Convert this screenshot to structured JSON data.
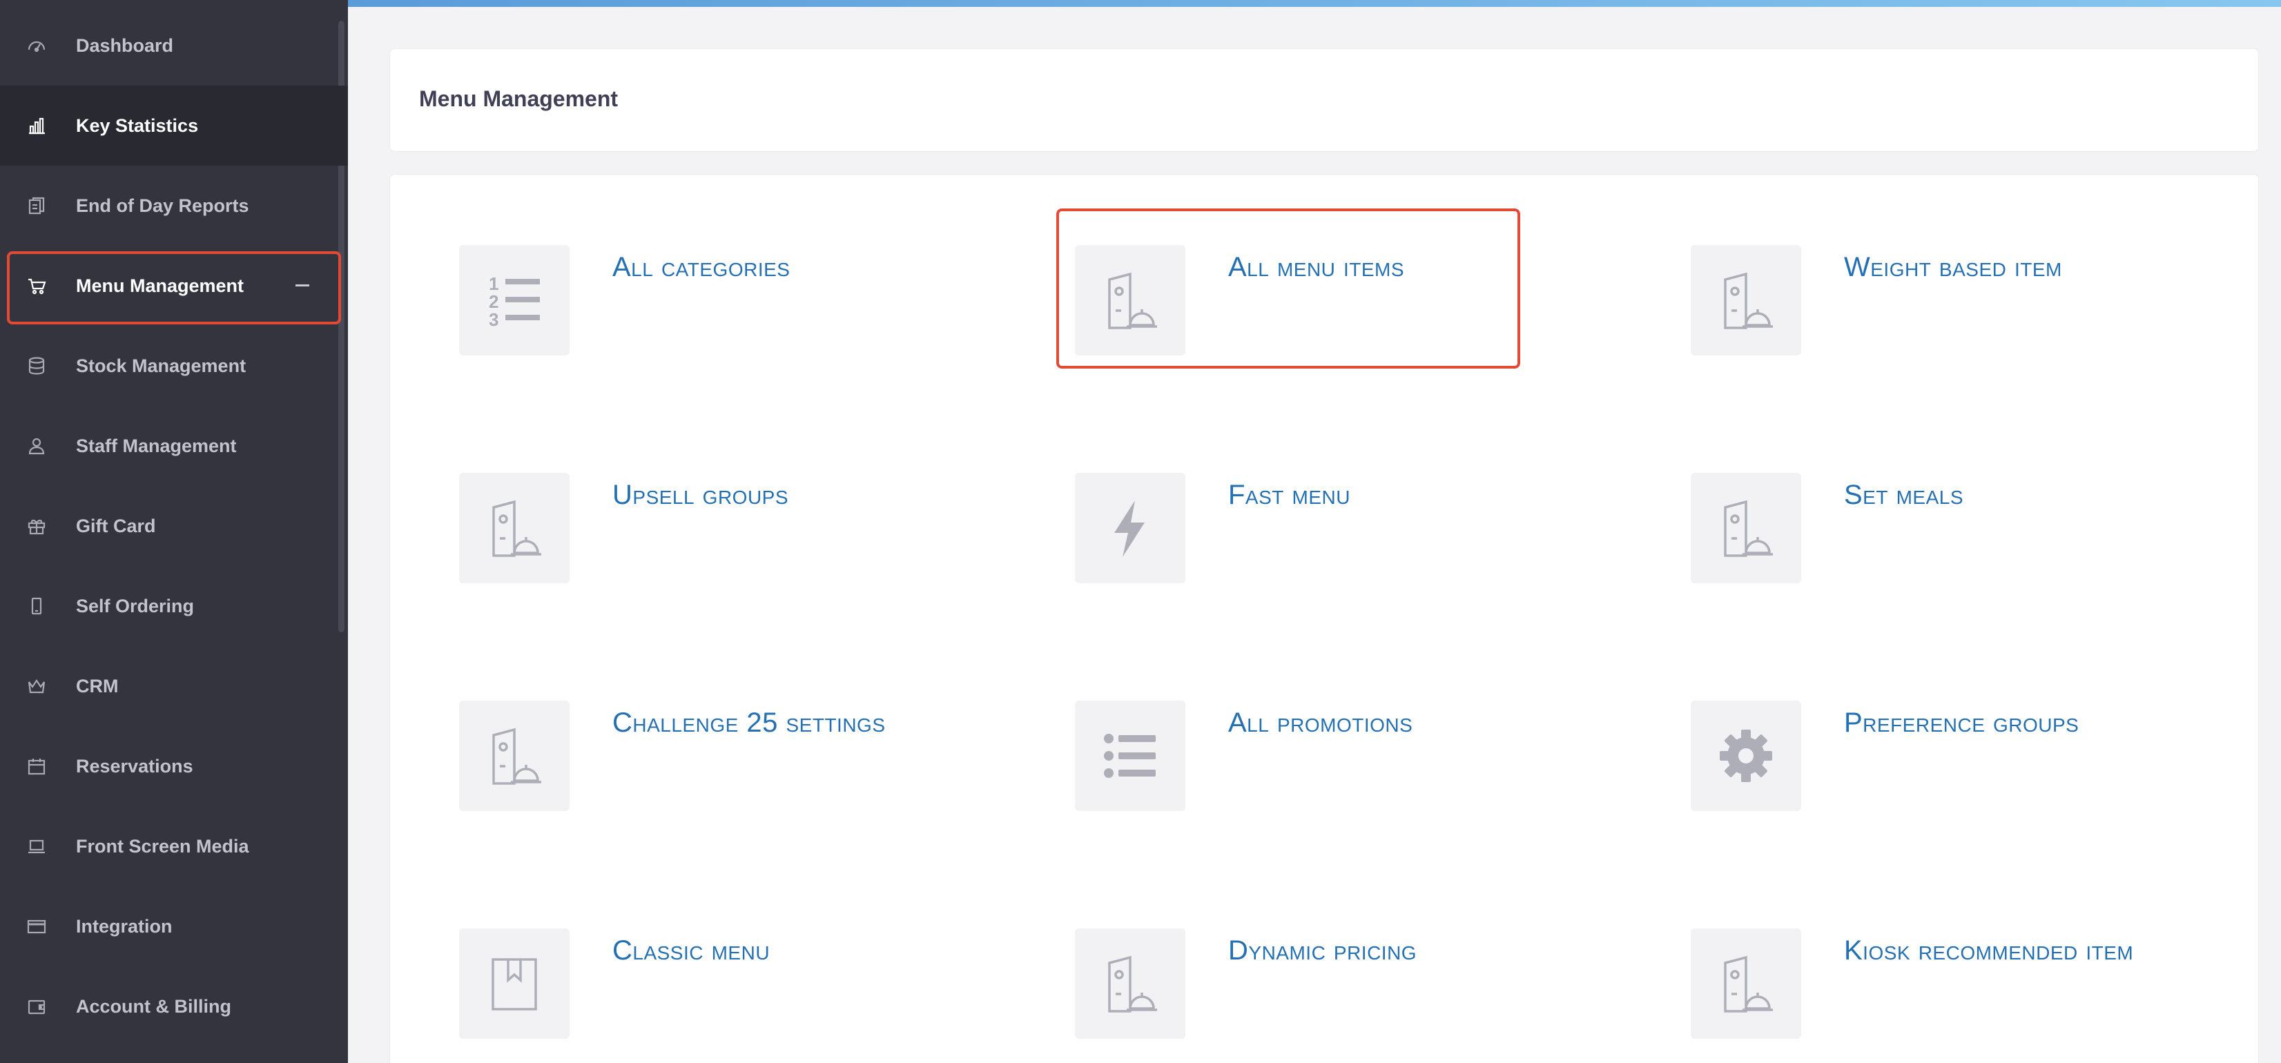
{
  "sidebar": {
    "items": [
      {
        "label": "Dashboard",
        "icon": "dashboard-icon"
      },
      {
        "label": "Key Statistics",
        "icon": "bar-chart-icon"
      },
      {
        "label": "End of Day Reports",
        "icon": "reports-icon"
      },
      {
        "label": "Menu Management",
        "icon": "cart-icon"
      },
      {
        "label": "Stock Management",
        "icon": "database-icon"
      },
      {
        "label": "Staff Management",
        "icon": "user-icon"
      },
      {
        "label": "Gift Card",
        "icon": "gift-icon"
      },
      {
        "label": "Self Ordering",
        "icon": "mobile-icon"
      },
      {
        "label": "CRM",
        "icon": "crown-icon"
      },
      {
        "label": "Reservations",
        "icon": "calendar-icon"
      },
      {
        "label": "Front Screen Media",
        "icon": "laptop-icon"
      },
      {
        "label": "Integration",
        "icon": "card-icon"
      },
      {
        "label": "Account & Billing",
        "icon": "wallet-icon"
      }
    ],
    "active_item": "Key Statistics",
    "expanded_item": "Menu Management",
    "collapse_symbol": "−"
  },
  "header": {
    "title": "Menu Management"
  },
  "tiles": [
    {
      "label": "All categories",
      "icon": "numbered-list-icon"
    },
    {
      "label": "All menu items",
      "icon": "menu-service-icon"
    },
    {
      "label": "Weight based item",
      "icon": "menu-service-icon"
    },
    {
      "label": "Upsell groups",
      "icon": "menu-service-icon"
    },
    {
      "label": "Fast menu",
      "icon": "lightning-icon"
    },
    {
      "label": "Set meals",
      "icon": "menu-service-icon"
    },
    {
      "label": "Challenge 25 settings",
      "icon": "menu-service-icon"
    },
    {
      "label": "All promotions",
      "icon": "bullet-list-icon"
    },
    {
      "label": "Preference groups",
      "icon": "gear-icon"
    },
    {
      "label": "Classic menu",
      "icon": "book-icon"
    },
    {
      "label": "Dynamic pricing",
      "icon": "menu-service-icon"
    },
    {
      "label": "Kiosk recommended item",
      "icon": "menu-service-icon"
    }
  ],
  "colors": {
    "sidebar_bg": "#34343f",
    "sidebar_active_bg": "#292931",
    "tile_label": "#2470b3",
    "highlight": "#e34a36"
  }
}
